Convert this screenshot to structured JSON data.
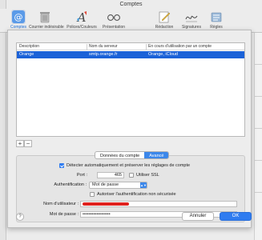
{
  "window": {
    "title": "Comptes"
  },
  "toolbar": {
    "items": [
      {
        "label": "Comptes",
        "icon": "at-icon"
      },
      {
        "label": "Courrier indésirable",
        "icon": "trash-icon"
      },
      {
        "label": "Polices/Couleurs",
        "icon": "font-icon"
      },
      {
        "label": "Présentation",
        "icon": "glasses-icon"
      },
      {
        "label": "Rédaction",
        "icon": "compose-icon"
      },
      {
        "label": "Signatures",
        "icon": "signature-icon"
      },
      {
        "label": "Règles",
        "icon": "rules-icon"
      }
    ]
  },
  "table": {
    "columns": [
      "Description",
      "Nom du serveur",
      "En cours d'utilisation par un compte"
    ],
    "rows": [
      {
        "description": "Orange",
        "server": "smtp.orange.fr",
        "used_by": "Orange, iCloud"
      }
    ]
  },
  "list_controls": {
    "add": "+",
    "remove": "−"
  },
  "tabs": {
    "info": "Données du compte",
    "advanced": "Avancé"
  },
  "form": {
    "auto_detect": "Détecter automatiquement et préserver les réglages de compte",
    "port_label": "Port :",
    "port_value": "465",
    "ssl_label": "Utiliser SSL",
    "auth_label": "Authentification :",
    "auth_value": "Mot de passe",
    "insecure_label": "Autoriser l'authentification non sécurisée",
    "username_label": "Nom d'utilisateur :",
    "password_label": "Mot de passe :",
    "password_value": "••••••••••••••••••"
  },
  "buttons": {
    "help": "?",
    "cancel": "Annuler",
    "ok": "OK"
  },
  "colors": {
    "accent": "#2f7cf0",
    "selection": "#1b62d8",
    "redaction": "#e0221e"
  }
}
